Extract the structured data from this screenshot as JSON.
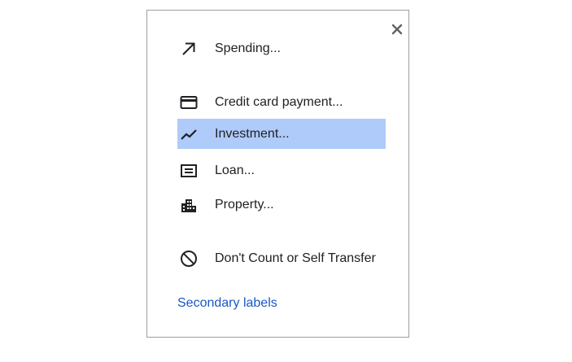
{
  "menu": {
    "close_icon": "close-icon",
    "items": [
      {
        "label": "Spending...",
        "icon": "arrow-up-right-icon"
      },
      {
        "label": "Credit card payment...",
        "icon": "credit-card-icon"
      },
      {
        "label": "Investment...",
        "icon": "trending-up-icon",
        "selected": true
      },
      {
        "label": "Loan...",
        "icon": "loan-document-icon"
      },
      {
        "label": "Property...",
        "icon": "building-icon"
      },
      {
        "label": "Don't Count or Self Transfer",
        "icon": "block-icon"
      }
    ],
    "secondary_link": "Secondary labels"
  },
  "colors": {
    "selected_background": "#aecbfa",
    "link": "#1a56c4",
    "text": "#202124",
    "border": "#9e9e9e"
  }
}
